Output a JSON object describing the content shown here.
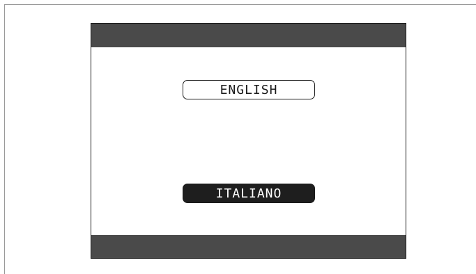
{
  "languages": {
    "english": "ENGLISH",
    "italiano": "ITALIANO",
    "selected": "ITALIANO"
  },
  "colors": {
    "bar": "#4a4a4a",
    "selected_bg": "#1e1e1e",
    "selected_text": "#ffffff",
    "border": "#1a1a1a"
  }
}
